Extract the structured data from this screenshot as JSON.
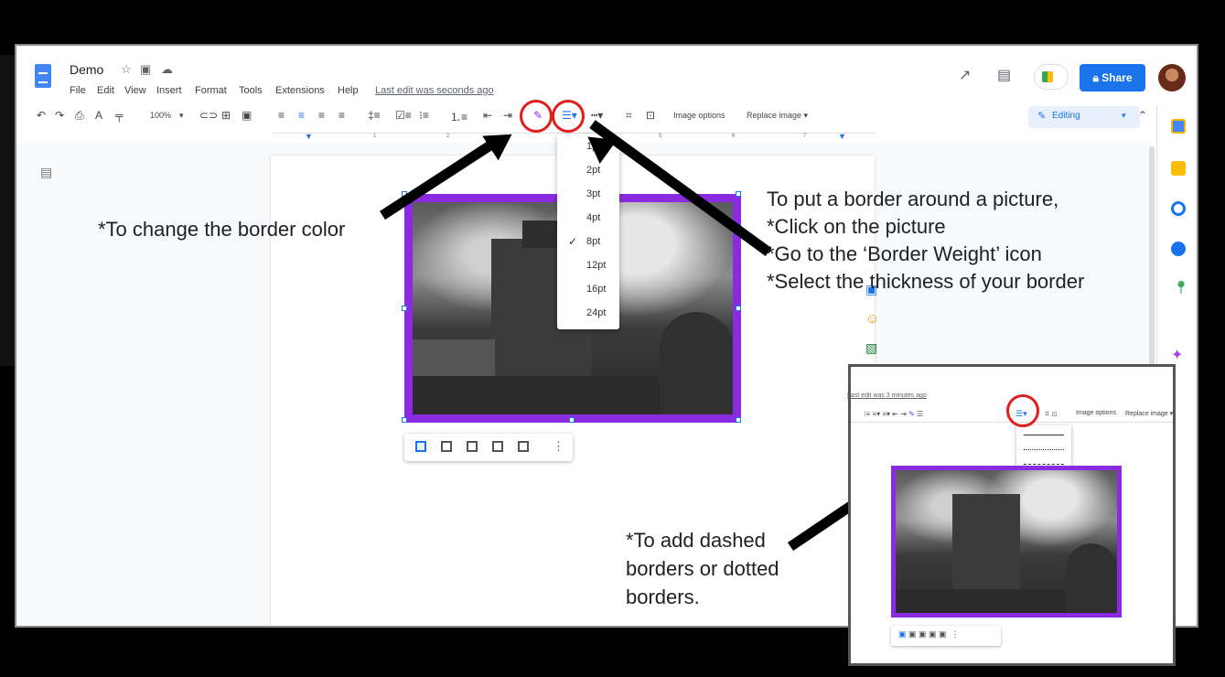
{
  "header": {
    "doc_title": "Demo",
    "title_icons": [
      "star-icon",
      "folder-icon",
      "cloud-icon"
    ],
    "menu": [
      "File",
      "Edit",
      "View",
      "Insert",
      "Format",
      "Tools",
      "Extensions",
      "Help"
    ],
    "last_edit": "Last edit was seconds ago",
    "share_label": "Share",
    "share_icon": "lock-icon"
  },
  "toolbar": {
    "zoom": "100%",
    "image_options": "Image options",
    "replace_image": "Replace image ▾",
    "mode": "Editing",
    "highlighted_tools": [
      "border-color-icon",
      "border-weight-icon"
    ]
  },
  "ruler": {
    "marks": [
      "1",
      "2",
      "5",
      "6",
      "7"
    ]
  },
  "border_weight_menu": {
    "options": [
      "1pt",
      "2pt",
      "3pt",
      "4pt",
      "8pt",
      "12pt",
      "16pt",
      "24pt"
    ],
    "selected": "8pt"
  },
  "image": {
    "border_color": "#8a2be2",
    "description_icon": "haunted-house-photo"
  },
  "annotations": {
    "border_color": "*To change the border color",
    "instructions": [
      "To put a border around a picture,",
      "*Click on the picture",
      "*Go to the ‘Border Weight’ icon",
      "*Select the thickness of your border"
    ],
    "dashed": [
      "*To add dashed",
      "borders or dotted",
      "borders."
    ],
    "highlight_color": "#e01e1e"
  },
  "inset": {
    "last_edit": "Last edit was 3 minutes ago",
    "image_options": "Image options",
    "replace_image": "Replace image ▾",
    "dash_options": [
      "solid",
      "dotted",
      "dashed"
    ]
  },
  "colors": {
    "share_blue": "#1a73e8",
    "doc_blue": "#4285f4",
    "editing_bg": "#e8f0fe"
  }
}
